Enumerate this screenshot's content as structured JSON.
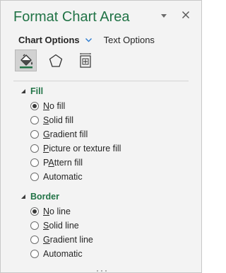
{
  "title": "Format Chart Area",
  "pin_icon": "triangle-down",
  "close_icon": "x",
  "tabs": {
    "chart_options": "Chart Options",
    "text_options": "Text Options"
  },
  "icon_tabs": [
    "fill-line-icon",
    "effects-pentagon-icon",
    "size-properties-icon"
  ],
  "fill": {
    "heading": "Fill",
    "options": [
      {
        "key": "N",
        "rest": "o fill",
        "checked": true
      },
      {
        "key": "S",
        "rest": "olid fill",
        "checked": false
      },
      {
        "key": "G",
        "rest": "radient fill",
        "checked": false
      },
      {
        "key": "P",
        "rest": "icture or texture fill",
        "checked": false
      },
      {
        "key": "A",
        "rest": "",
        "pre": "P",
        "post": "ttern fill",
        "checked": false
      },
      {
        "key": "",
        "rest": "Automatic",
        "checked": false
      }
    ]
  },
  "border": {
    "heading": "Border",
    "options": [
      {
        "key": "N",
        "rest": "o line",
        "checked": true
      },
      {
        "key": "S",
        "rest": "olid line",
        "checked": false
      },
      {
        "key": "G",
        "rest": "radient line",
        "checked": false
      },
      {
        "key": "",
        "rest": "Automatic",
        "checked": false
      }
    ]
  },
  "fill_labels": [
    "No fill",
    "Solid fill",
    "Gradient fill",
    "Picture or texture fill",
    "Pattern fill",
    "Automatic"
  ],
  "border_labels": [
    "No line",
    "Solid line",
    "Gradient line",
    "Automatic"
  ],
  "accent_color": "#217346"
}
